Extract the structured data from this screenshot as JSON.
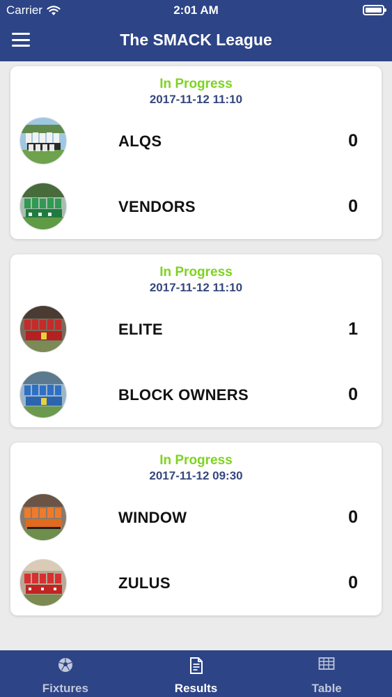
{
  "status_bar": {
    "carrier": "Carrier",
    "time": "2:01 AM"
  },
  "header": {
    "title": "The SMACK League"
  },
  "matches": [
    {
      "status": "In Progress",
      "datetime": "2017-11-12 11:10",
      "teams": [
        {
          "name": "ALQS",
          "score": "0",
          "photo": "team-photo-white-kit"
        },
        {
          "name": "VENDORS",
          "score": "0",
          "photo": "team-photo-green-kit"
        }
      ]
    },
    {
      "status": "In Progress",
      "datetime": "2017-11-12 11:10",
      "teams": [
        {
          "name": "ELITE",
          "score": "1",
          "photo": "team-photo-red-kit"
        },
        {
          "name": "BLOCK OWNERS",
          "score": "0",
          "photo": "team-photo-blue-kit"
        }
      ]
    },
    {
      "status": "In Progress",
      "datetime": "2017-11-12 09:30",
      "teams": [
        {
          "name": "WINDOW",
          "score": "0",
          "photo": "team-photo-orange-kit"
        },
        {
          "name": "ZULUS",
          "score": "0",
          "photo": "team-photo-red-kit"
        }
      ]
    }
  ],
  "tabs": [
    {
      "label": "Fixtures",
      "icon": "soccer-ball-icon"
    },
    {
      "label": "Results",
      "icon": "document-icon",
      "selected": true
    },
    {
      "label": "Table",
      "icon": "table-icon"
    }
  ],
  "colors": {
    "primary": "#2d4486",
    "status_green": "#7ed321",
    "date_blue": "#35477d"
  }
}
